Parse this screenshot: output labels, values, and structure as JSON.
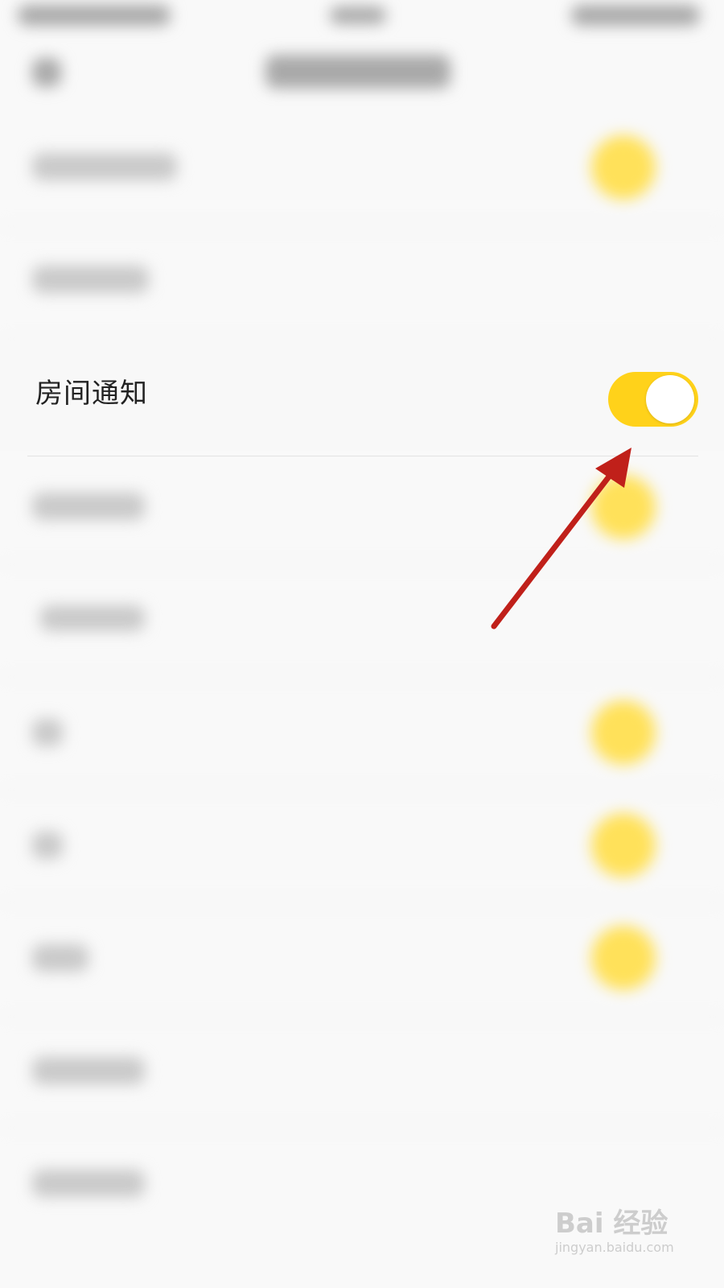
{
  "room_notification": {
    "label": "房间通知",
    "toggle_state": "on",
    "toggle_color": "#ffd21a"
  },
  "annotation": {
    "arrow_color": "#c0201a"
  },
  "watermark": {
    "main_text": "Bai 经验",
    "sub_text": "jingyan.baidu.com"
  },
  "colors": {
    "background": "#f9f9f9",
    "toggle_yellow": "#ffd21a",
    "label_text": "#222222"
  }
}
